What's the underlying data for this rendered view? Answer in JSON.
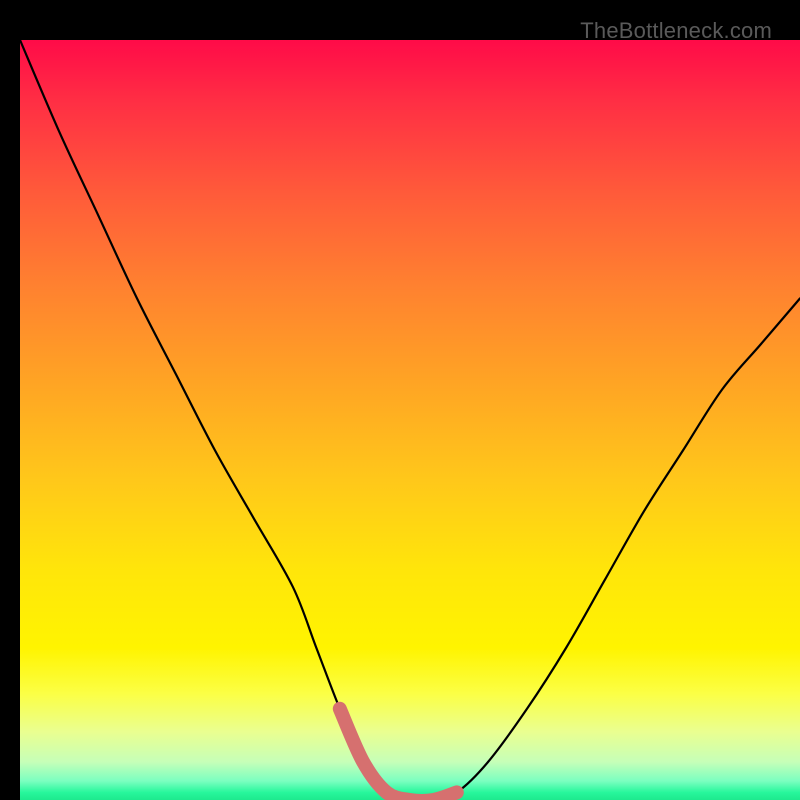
{
  "watermark": "TheBottleneck.com",
  "chart_data": {
    "type": "line",
    "title": "",
    "xlabel": "",
    "ylabel": "",
    "xlim": [
      0,
      100
    ],
    "ylim": [
      0,
      100
    ],
    "series": [
      {
        "name": "bottleneck-curve",
        "x": [
          0,
          5,
          10,
          15,
          20,
          25,
          30,
          35,
          38,
          41,
          44,
          47,
          50,
          53,
          56,
          60,
          65,
          70,
          75,
          80,
          85,
          90,
          95,
          100
        ],
        "y": [
          100,
          88,
          77,
          66,
          56,
          46,
          37,
          28,
          20,
          12,
          5,
          1,
          0,
          0,
          1,
          5,
          12,
          20,
          29,
          38,
          46,
          54,
          60,
          66
        ]
      }
    ],
    "highlight": {
      "name": "flat-zone",
      "color": "#d6706f",
      "x": [
        41,
        56
      ],
      "y_approx": 2
    },
    "background_gradient_stops": [
      {
        "p": 0.0,
        "c": "#ff0b48"
      },
      {
        "p": 0.45,
        "c": "#ffa424"
      },
      {
        "p": 0.8,
        "c": "#fff400"
      },
      {
        "p": 1.0,
        "c": "#1de98e"
      }
    ]
  }
}
